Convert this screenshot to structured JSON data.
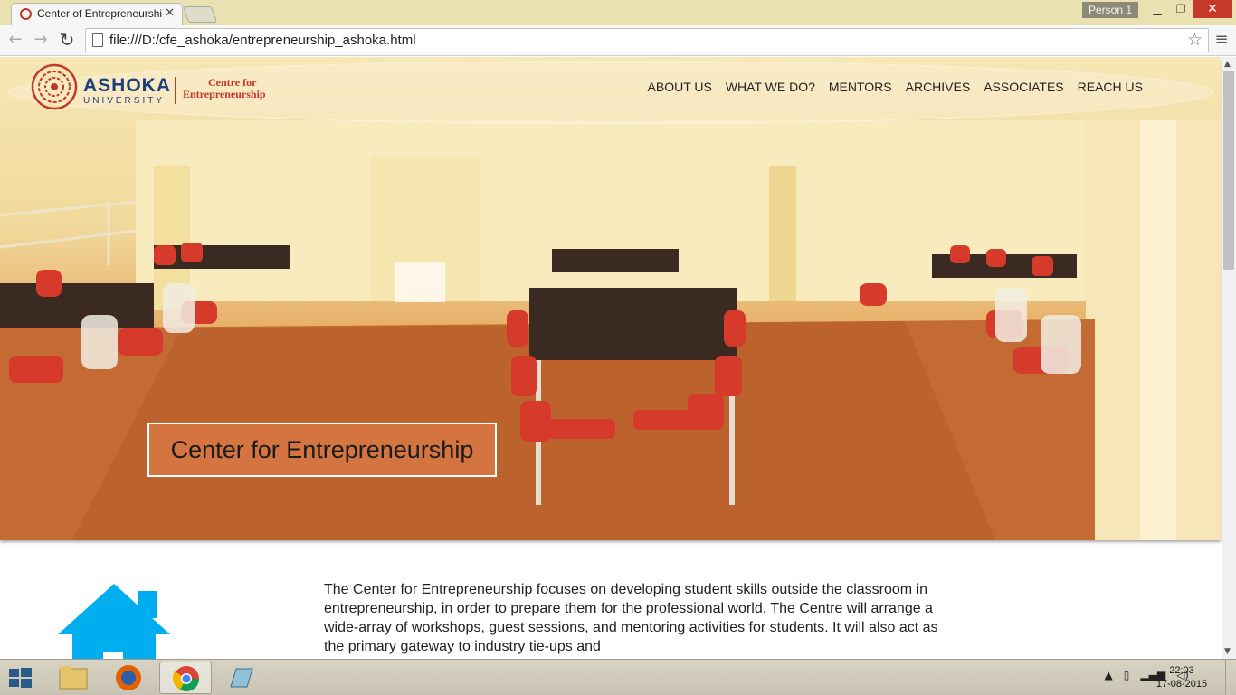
{
  "browser": {
    "tab_title": "Center of Entrepreneurshi",
    "profile": "Person 1",
    "url": "file:///D:/cfe_ashoka/entrepreneurship_ashoka.html"
  },
  "site": {
    "logo": {
      "name": "ASHOKA",
      "subtitle": "UNIVERSITY",
      "line1": "Centre for",
      "line2": "Entrepreneurship"
    },
    "nav": [
      "ABOUT US",
      "WHAT WE DO?",
      "MENTORS",
      "ARCHIVES",
      "ASSOCIATES",
      "REACH US"
    ],
    "hero_title": "Center for Entrepreneurship",
    "intro_text": "The Center for Entrepreneurship focuses on developing student skills outside the classroom in entrepreneurship, in order to prepare them for the professional world. The Centre will arrange a wide-array of workshops, guest sessions, and mentoring activities for students. It will also act as the primary gateway to industry tie-ups and",
    "accent_color": "#c0392b",
    "icon_color": "#00aeef"
  },
  "taskbar": {
    "apps": [
      "start-icon",
      "file-explorer-icon",
      "firefox-icon",
      "chrome-icon",
      "app-icon"
    ],
    "time": "22:03",
    "date": "17-08-2015"
  }
}
